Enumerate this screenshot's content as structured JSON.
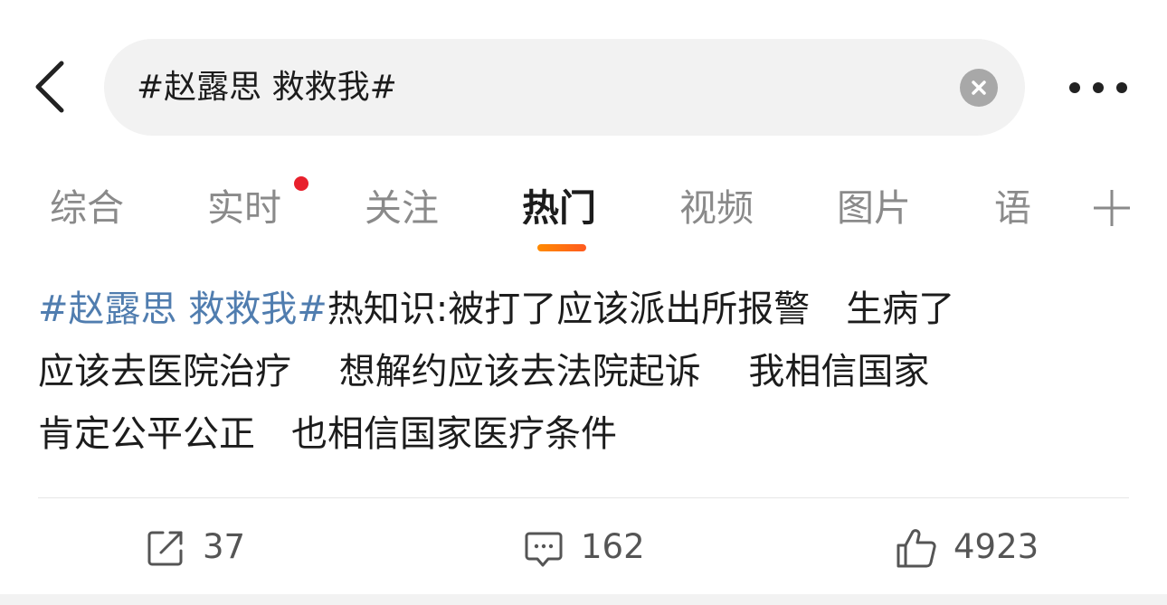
{
  "search": {
    "query": "#赵露思 救救我#"
  },
  "tabs": [
    {
      "label": "综合"
    },
    {
      "label": "实时"
    },
    {
      "label": "关注"
    },
    {
      "label": "热门"
    },
    {
      "label": "视频"
    },
    {
      "label": "图片"
    },
    {
      "label": "语"
    }
  ],
  "active_tab": "热门",
  "post": {
    "hashtag": "#赵露思 救救我#",
    "line1_rest": "热知识:被打了应该派出所报警　生病了",
    "line2": "应该去医院治疗　 想解约应该去法院起诉　 我相信国家",
    "line3": "肯定公平公正　也相信国家医疗条件"
  },
  "actions": {
    "repost_count": "37",
    "comment_count": "162",
    "like_count": "4923"
  },
  "colors": {
    "hashtag": "#507daf",
    "tab_indicator": "#ff7a00",
    "notification_dot": "#e8202c"
  },
  "icons": {
    "back": "chevron-left-icon",
    "clear": "close-circle-icon",
    "more": "more-dots-icon",
    "add_tab": "plus-icon",
    "repost": "repost-icon",
    "comment": "comment-icon",
    "like": "thumbs-up-icon"
  }
}
